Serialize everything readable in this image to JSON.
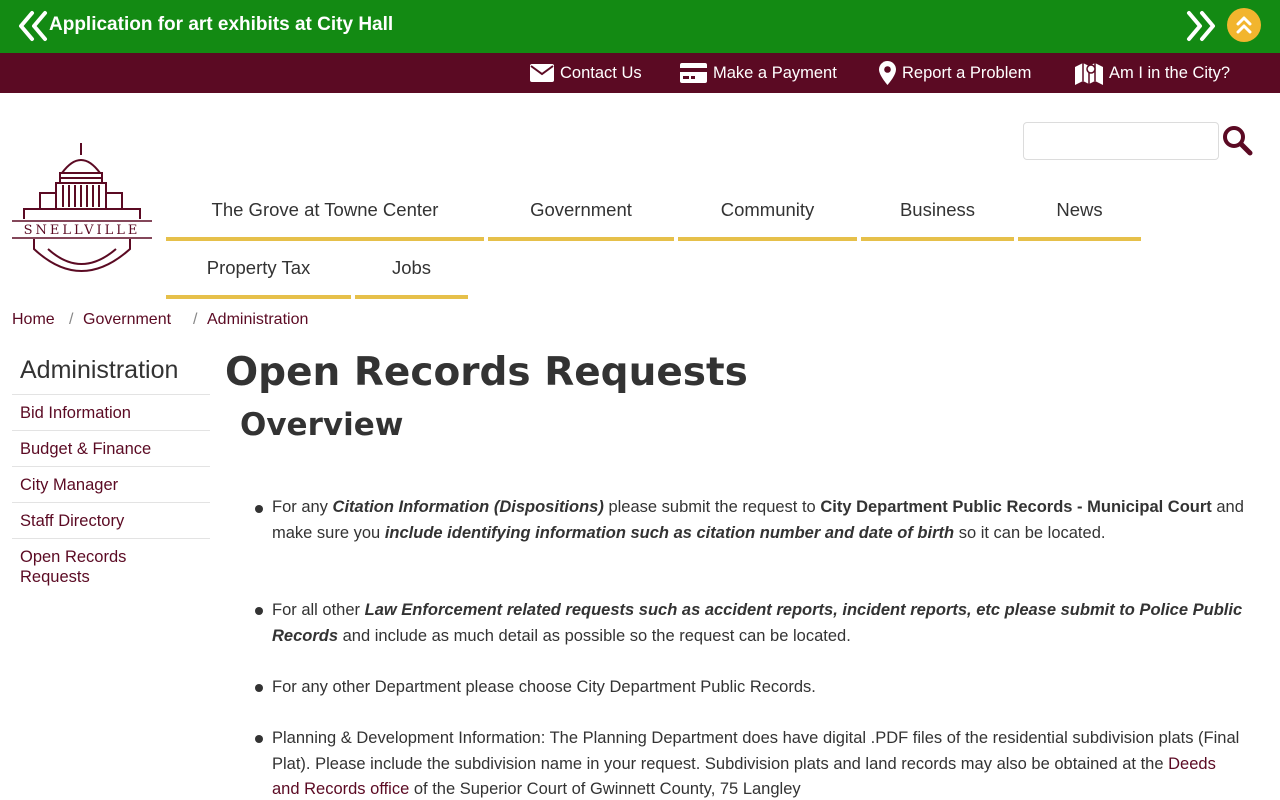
{
  "alert": {
    "text": "Application for art exhibits at City Hall"
  },
  "utility_links": [
    {
      "label": "Contact Us",
      "icon": "envelope-icon"
    },
    {
      "label": "Make a Payment",
      "icon": "credit-card-icon"
    },
    {
      "label": "Report a Problem",
      "icon": "map-marker-icon"
    },
    {
      "label": "Am I in the City?",
      "icon": "map-icon"
    }
  ],
  "logo": {
    "text": "SNELLVILLE"
  },
  "search": {
    "placeholder": ""
  },
  "nav": [
    {
      "label": "The Grove at Towne Center"
    },
    {
      "label": "Government"
    },
    {
      "label": "Community"
    },
    {
      "label": "Business"
    },
    {
      "label": "News"
    },
    {
      "label": "Property Tax"
    },
    {
      "label": "Jobs"
    }
  ],
  "breadcrumb": [
    {
      "label": "Home"
    },
    {
      "label": "Government"
    },
    {
      "label": "Administration"
    }
  ],
  "sidebar": {
    "title": "Administration",
    "items": [
      {
        "label": "Bid Information"
      },
      {
        "label": "Budget & Finance"
      },
      {
        "label": "City Manager"
      },
      {
        "label": "Staff Directory"
      },
      {
        "label": "Open Records Requests"
      }
    ]
  },
  "main": {
    "title": "Open Records Requests",
    "subtitle": "Overview",
    "p1": {
      "a": "For any ",
      "b": "Citation Information (Dispositions)",
      "c": " please submit the request to ",
      "d": "City Department Public Records - Municipal Court",
      "e": " and make sure you ",
      "f": "include identifying information such as citation number and date of birth",
      "g": " so it can be located."
    },
    "p2": {
      "a": "For all other ",
      "b": "Law Enforcement related requests  such as accident reports, incident reports, etc please submit to Police Public Records",
      "c": " and include as much detail as possible so the request can be located."
    },
    "p3": {
      "a": "For any other Department please choose City Department Public Records."
    },
    "p4": {
      "a": "Planning & Development Information:  The Planning Department does have digital .PDF files of the residential subdivision plats (Final Plat). Please include the subdivision name in your request. Subdivision plats and land records may also be obtained at the ",
      "b": "Deeds and Records office",
      "c": " of the Superior Court of Gwinnett County, 75 Langley"
    }
  },
  "colors": {
    "alert_green": "#138a13",
    "brand_maroon": "#5b0a23",
    "accent_gold": "#e6c04a",
    "scroll_up_gold": "#f2b52e"
  }
}
